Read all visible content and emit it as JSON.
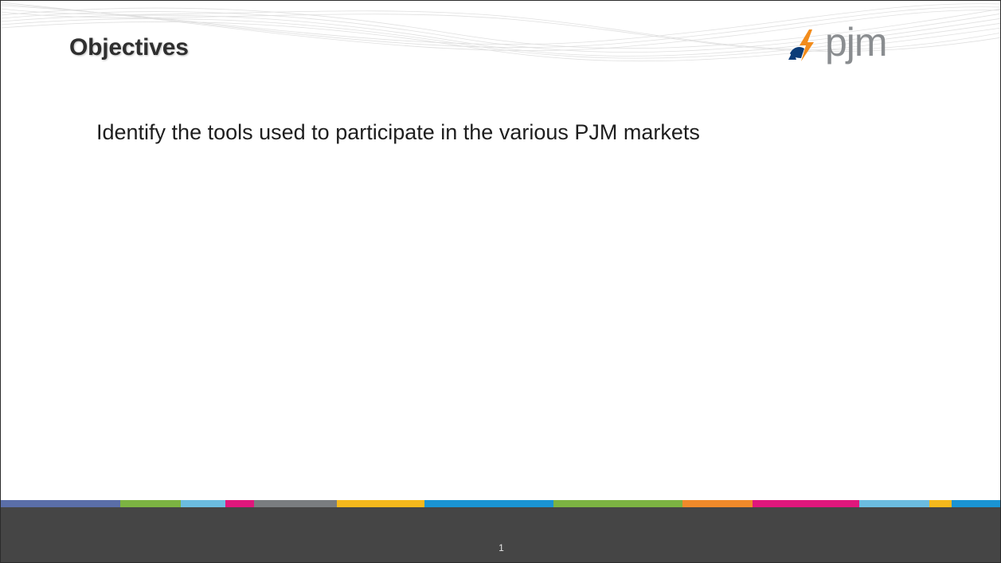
{
  "slide": {
    "title": "Objectives",
    "body_text": "Identify the tools used to participate in the various PJM markets",
    "page_number": "1"
  },
  "logo": {
    "text": "pjm",
    "icon": "pjm-lightning-mark-icon"
  },
  "colors": {
    "footer_background": "#454545",
    "title_text": "#2f2f2f",
    "logo_gray": "#8a8d90",
    "logo_blue": "#0b3c78",
    "logo_orange": "#f28c1c"
  },
  "accent_bar_colors": [
    "#5a6ea8",
    "#7cb342",
    "#6bbce0",
    "#e0177c",
    "#7a7d80",
    "#f5b81c",
    "#1a94d4",
    "#7cb342",
    "#f08a2a",
    "#e0177c",
    "#6bbce0",
    "#f5b81c",
    "#1a94d4"
  ]
}
